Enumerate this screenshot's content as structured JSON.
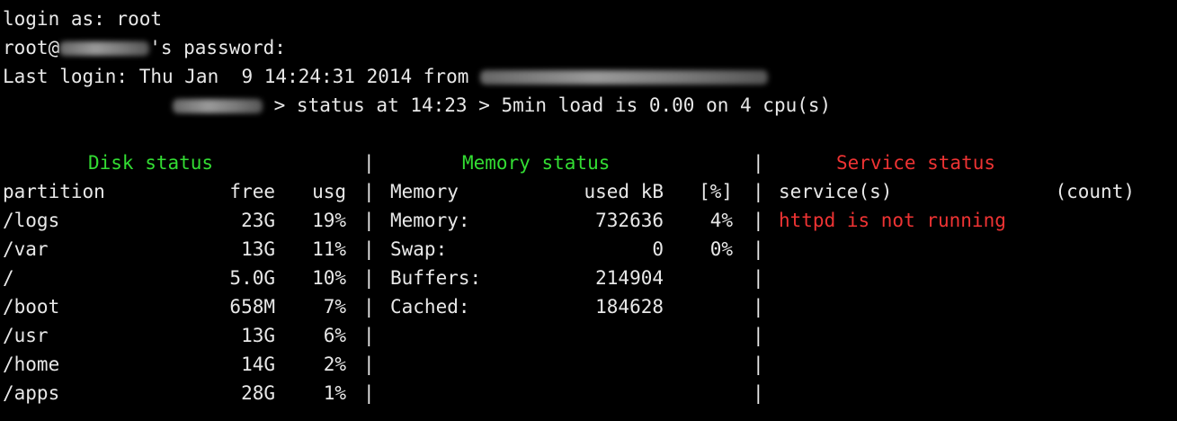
{
  "header": {
    "login_line": "login as: root",
    "password_prefix": "root@",
    "password_suffix": "'s password:",
    "last_login": "Last login: Thu Jan  9 14:24:31 2014 from ",
    "status_line": " > status at 14:23 > 5min load is 0.00 on 4 cpu(s)"
  },
  "disk": {
    "title": "Disk status",
    "headers": [
      "partition",
      "free",
      "usg"
    ],
    "rows": [
      [
        "/logs",
        "23G",
        "19%"
      ],
      [
        "/var",
        "13G",
        "11%"
      ],
      [
        "/",
        "5.0G",
        "10%"
      ],
      [
        "/boot",
        "658M",
        "7%"
      ],
      [
        "/usr",
        "13G",
        "6%"
      ],
      [
        "/home",
        "14G",
        "2%"
      ],
      [
        "/apps",
        "28G",
        "1%"
      ]
    ]
  },
  "memory": {
    "title": "Memory status",
    "headers": [
      "Memory",
      "used kB",
      "[%]"
    ],
    "rows": [
      [
        "Memory:",
        "732636",
        "4%"
      ],
      [
        "Swap:",
        "0",
        "0%"
      ],
      [
        "Buffers:",
        "214904",
        ""
      ],
      [
        "Cached:",
        "184628",
        ""
      ]
    ]
  },
  "service": {
    "title": "Service status",
    "headers": [
      "service(s)",
      "(count)"
    ],
    "rows": [
      "httpd is not running"
    ]
  },
  "separator": "|",
  "colors": {
    "background": "#000000",
    "text": "#e8e8e8",
    "green": "#33dd33",
    "red": "#ee3333"
  }
}
